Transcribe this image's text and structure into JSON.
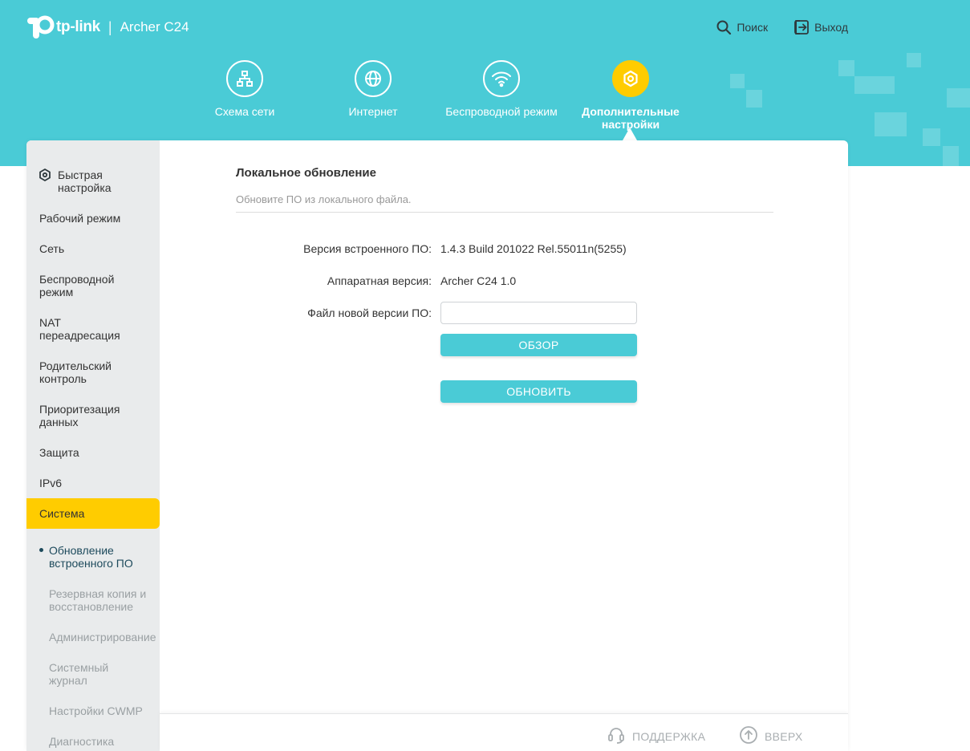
{
  "brand": {
    "logo_text": "tp-link",
    "separator": "|",
    "model": "Archer C24",
    "logo_color": "#ffffff"
  },
  "colors": {
    "header_bg": "#4acbd6",
    "accent_yellow": "#ffcc00",
    "button_bg": "#4acbd6",
    "sidebar_bg": "#e9ebec"
  },
  "top_actions": {
    "search": {
      "label": "Поиск",
      "icon": "search-icon"
    },
    "logout": {
      "label": "Выход",
      "icon": "logout-icon"
    }
  },
  "nav": {
    "items": [
      {
        "label": "Схема сети",
        "icon": "network-map-icon"
      },
      {
        "label": "Интернет",
        "icon": "globe-icon"
      },
      {
        "label": "Беспроводной режим",
        "icon": "wifi-icon"
      },
      {
        "label": "Дополнительные настройки",
        "icon": "gear-icon",
        "active": true
      }
    ]
  },
  "sidebar": {
    "quick_setup": {
      "label": "Быстрая настройка",
      "icon": "gear-icon"
    },
    "items": [
      {
        "label": "Рабочий режим"
      },
      {
        "label": "Сеть"
      },
      {
        "label": "Беспроводной режим"
      },
      {
        "label": "NAT переадресация"
      },
      {
        "label": "Родительский контроль"
      },
      {
        "label": "Приоритезация данных"
      },
      {
        "label": "Защита"
      },
      {
        "label": "IPv6"
      }
    ],
    "active_section": "Система",
    "subitems": [
      {
        "label": "Обновление встроенного ПО",
        "current": true
      },
      {
        "label": "Резервная копия и восстановление"
      },
      {
        "label": "Администрирование"
      },
      {
        "label": "Системный журнал"
      },
      {
        "label": "Настройки CWMP"
      },
      {
        "label": "Диагностика"
      }
    ]
  },
  "main": {
    "section_title": "Локальное обновление",
    "section_desc": "Обновите ПО из локального файла.",
    "firmware_label": "Версия встроенного ПО:",
    "firmware_value": "1.4.3 Build 201022 Rel.55011n(5255)",
    "hardware_label": "Аппаратная версия:",
    "hardware_value": "Archer C24 1.0",
    "file_label": "Файл новой версии ПО:",
    "file_value": "",
    "browse_button": "ОБЗОР",
    "update_button": "ОБНОВИТЬ"
  },
  "footer": {
    "support": {
      "label": "ПОДДЕРЖКА",
      "icon": "headset-icon"
    },
    "top": {
      "label": "ВВЕРХ",
      "icon": "arrow-up-icon"
    }
  }
}
